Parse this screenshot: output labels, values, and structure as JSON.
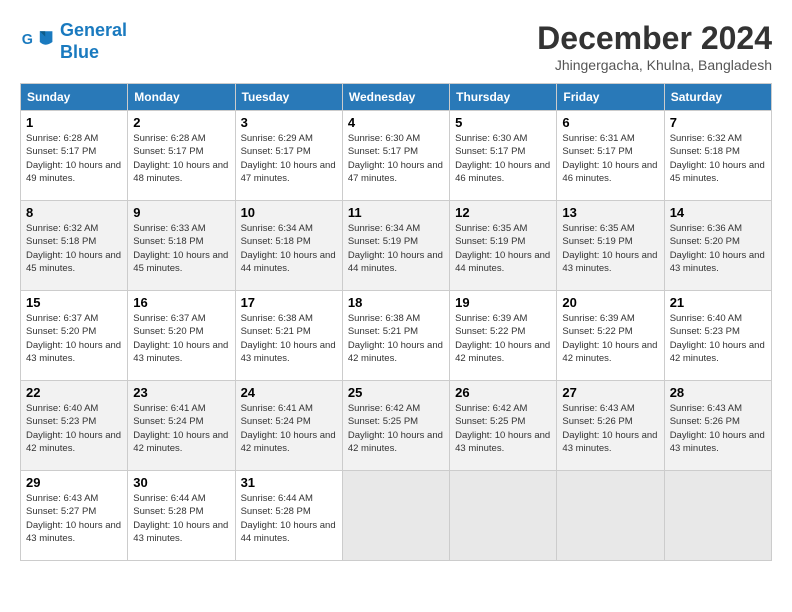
{
  "header": {
    "logo_line1": "General",
    "logo_line2": "Blue",
    "month": "December 2024",
    "location": "Jhingergacha, Khulna, Bangladesh"
  },
  "weekdays": [
    "Sunday",
    "Monday",
    "Tuesday",
    "Wednesday",
    "Thursday",
    "Friday",
    "Saturday"
  ],
  "weeks": [
    [
      {
        "day": "1",
        "sunrise": "6:28 AM",
        "sunset": "5:17 PM",
        "daylight": "10 hours and 49 minutes."
      },
      {
        "day": "2",
        "sunrise": "6:28 AM",
        "sunset": "5:17 PM",
        "daylight": "10 hours and 48 minutes."
      },
      {
        "day": "3",
        "sunrise": "6:29 AM",
        "sunset": "5:17 PM",
        "daylight": "10 hours and 47 minutes."
      },
      {
        "day": "4",
        "sunrise": "6:30 AM",
        "sunset": "5:17 PM",
        "daylight": "10 hours and 47 minutes."
      },
      {
        "day": "5",
        "sunrise": "6:30 AM",
        "sunset": "5:17 PM",
        "daylight": "10 hours and 46 minutes."
      },
      {
        "day": "6",
        "sunrise": "6:31 AM",
        "sunset": "5:17 PM",
        "daylight": "10 hours and 46 minutes."
      },
      {
        "day": "7",
        "sunrise": "6:32 AM",
        "sunset": "5:18 PM",
        "daylight": "10 hours and 45 minutes."
      }
    ],
    [
      {
        "day": "8",
        "sunrise": "6:32 AM",
        "sunset": "5:18 PM",
        "daylight": "10 hours and 45 minutes."
      },
      {
        "day": "9",
        "sunrise": "6:33 AM",
        "sunset": "5:18 PM",
        "daylight": "10 hours and 45 minutes."
      },
      {
        "day": "10",
        "sunrise": "6:34 AM",
        "sunset": "5:18 PM",
        "daylight": "10 hours and 44 minutes."
      },
      {
        "day": "11",
        "sunrise": "6:34 AM",
        "sunset": "5:19 PM",
        "daylight": "10 hours and 44 minutes."
      },
      {
        "day": "12",
        "sunrise": "6:35 AM",
        "sunset": "5:19 PM",
        "daylight": "10 hours and 44 minutes."
      },
      {
        "day": "13",
        "sunrise": "6:35 AM",
        "sunset": "5:19 PM",
        "daylight": "10 hours and 43 minutes."
      },
      {
        "day": "14",
        "sunrise": "6:36 AM",
        "sunset": "5:20 PM",
        "daylight": "10 hours and 43 minutes."
      }
    ],
    [
      {
        "day": "15",
        "sunrise": "6:37 AM",
        "sunset": "5:20 PM",
        "daylight": "10 hours and 43 minutes."
      },
      {
        "day": "16",
        "sunrise": "6:37 AM",
        "sunset": "5:20 PM",
        "daylight": "10 hours and 43 minutes."
      },
      {
        "day": "17",
        "sunrise": "6:38 AM",
        "sunset": "5:21 PM",
        "daylight": "10 hours and 43 minutes."
      },
      {
        "day": "18",
        "sunrise": "6:38 AM",
        "sunset": "5:21 PM",
        "daylight": "10 hours and 42 minutes."
      },
      {
        "day": "19",
        "sunrise": "6:39 AM",
        "sunset": "5:22 PM",
        "daylight": "10 hours and 42 minutes."
      },
      {
        "day": "20",
        "sunrise": "6:39 AM",
        "sunset": "5:22 PM",
        "daylight": "10 hours and 42 minutes."
      },
      {
        "day": "21",
        "sunrise": "6:40 AM",
        "sunset": "5:23 PM",
        "daylight": "10 hours and 42 minutes."
      }
    ],
    [
      {
        "day": "22",
        "sunrise": "6:40 AM",
        "sunset": "5:23 PM",
        "daylight": "10 hours and 42 minutes."
      },
      {
        "day": "23",
        "sunrise": "6:41 AM",
        "sunset": "5:24 PM",
        "daylight": "10 hours and 42 minutes."
      },
      {
        "day": "24",
        "sunrise": "6:41 AM",
        "sunset": "5:24 PM",
        "daylight": "10 hours and 42 minutes."
      },
      {
        "day": "25",
        "sunrise": "6:42 AM",
        "sunset": "5:25 PM",
        "daylight": "10 hours and 42 minutes."
      },
      {
        "day": "26",
        "sunrise": "6:42 AM",
        "sunset": "5:25 PM",
        "daylight": "10 hours and 43 minutes."
      },
      {
        "day": "27",
        "sunrise": "6:43 AM",
        "sunset": "5:26 PM",
        "daylight": "10 hours and 43 minutes."
      },
      {
        "day": "28",
        "sunrise": "6:43 AM",
        "sunset": "5:26 PM",
        "daylight": "10 hours and 43 minutes."
      }
    ],
    [
      {
        "day": "29",
        "sunrise": "6:43 AM",
        "sunset": "5:27 PM",
        "daylight": "10 hours and 43 minutes."
      },
      {
        "day": "30",
        "sunrise": "6:44 AM",
        "sunset": "5:28 PM",
        "daylight": "10 hours and 43 minutes."
      },
      {
        "day": "31",
        "sunrise": "6:44 AM",
        "sunset": "5:28 PM",
        "daylight": "10 hours and 44 minutes."
      },
      null,
      null,
      null,
      null
    ]
  ]
}
